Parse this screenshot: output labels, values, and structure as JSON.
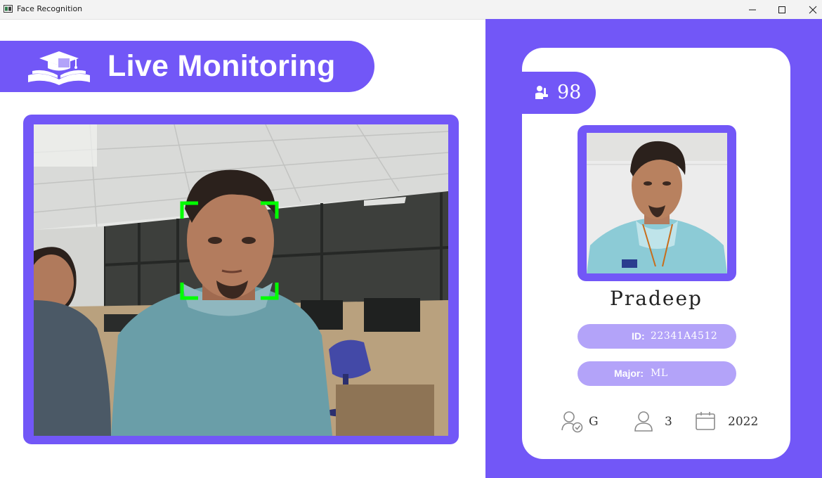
{
  "window": {
    "title": "Face Recognition",
    "controls": [
      "minimize-icon",
      "maximize-icon",
      "close-icon"
    ]
  },
  "header": {
    "logo_icon": "graduation-book-icon",
    "title": "Live Monitoring"
  },
  "camera": {
    "feed_icon": "live-camera-feed",
    "face_box_color": "#00ff00"
  },
  "student": {
    "attendance_icon": "person-raised-hand-icon",
    "total_attendance": "98",
    "name": "Pradeep",
    "id_label": "ID:",
    "id_value": "22341A4512",
    "major_label": "Major:",
    "major_value": "ML",
    "standing_icon": "user-check-icon",
    "standing": "G",
    "year_icon": "user-icon",
    "year": "3",
    "starting_year_icon": "calendar-icon",
    "starting_year": "2022"
  },
  "colors": {
    "accent": "#7257f7",
    "pill_light": "#b3a3f9",
    "background": "#ffffff"
  }
}
